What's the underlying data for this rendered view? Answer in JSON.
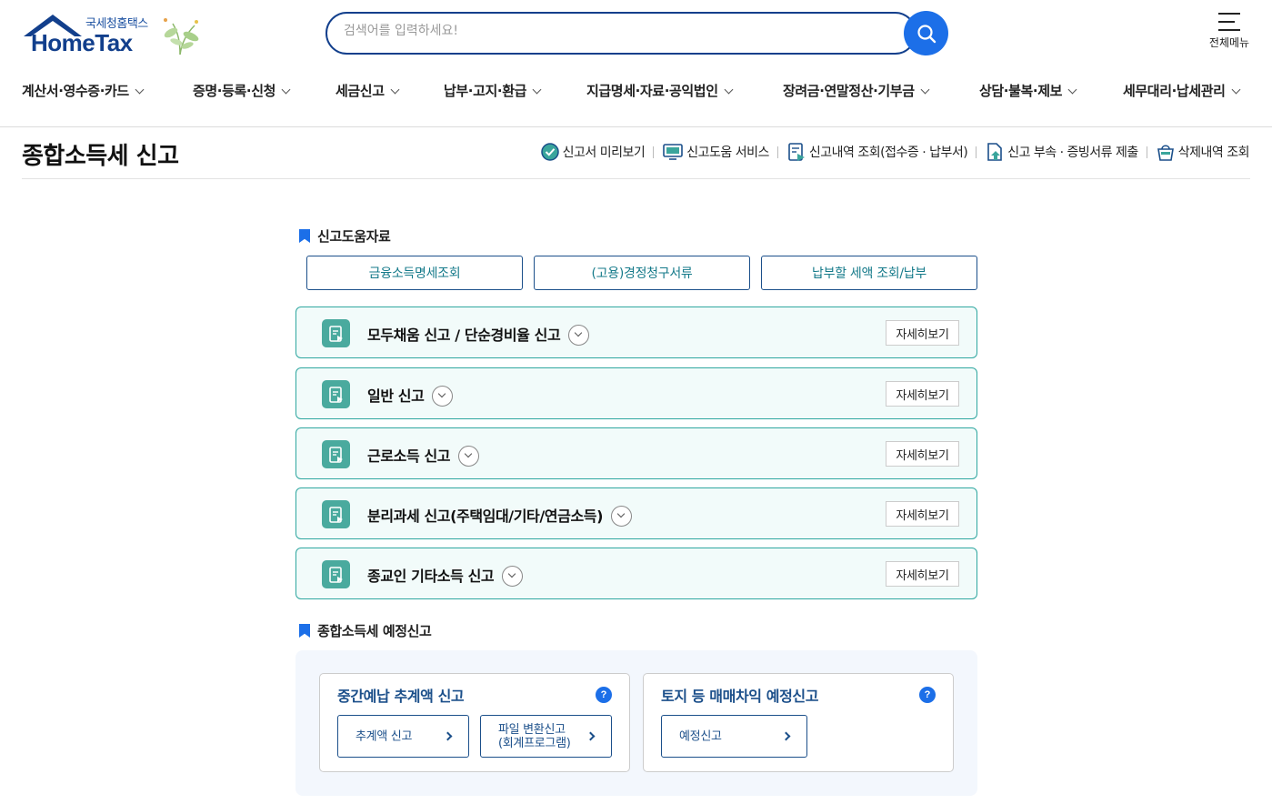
{
  "header": {
    "logo_sub": "국세청홈택스",
    "logo_main": "HomeTax",
    "search_placeholder": "검색어를 입력하세요!",
    "menu_label": "전체메뉴"
  },
  "gnb": [
    "계산서·영수증·카드",
    "증명·등록·신청",
    "세금신고",
    "납부·고지·환급",
    "지급명세·자료·공익법인",
    "장려금·연말정산·기부금",
    "상담·불복·제보",
    "세무대리·납세관리"
  ],
  "page": {
    "title": "종합소득세 신고",
    "quick_links": [
      {
        "label": "신고서 미리보기",
        "icon": "check-circle-icon"
      },
      {
        "label": "신고도움 서비스",
        "icon": "monitor-icon"
      },
      {
        "label": "신고내역 조회(접수증 · 납부서)",
        "icon": "document-search-icon"
      },
      {
        "label": "신고 부속 · 증빙서류 제출",
        "icon": "document-upload-icon"
      },
      {
        "label": "삭제내역 조회",
        "icon": "trash-basket-icon"
      }
    ]
  },
  "help_section": {
    "title": "신고도움자료",
    "buttons": [
      "금융소득명세조회",
      "(고용)경정청구서류",
      "납부할 세액 조회/납부"
    ]
  },
  "filing_types": [
    {
      "title": "모두채움 신고 / 단순경비율 신고",
      "more": "자세히보기"
    },
    {
      "title": "일반 신고",
      "more": "자세히보기"
    },
    {
      "title": "근로소득 신고",
      "more": "자세히보기"
    },
    {
      "title": "분리과세 신고(주택임대/기타/연금소득)",
      "more": "자세히보기"
    },
    {
      "title": "종교인 기타소득 신고",
      "more": "자세히보기"
    }
  ],
  "estimated_section": {
    "title": "종합소득세 예정신고",
    "cards": [
      {
        "title": "중간예납 추계액 신고",
        "help": "?",
        "buttons": [
          "추계액 신고",
          "파일 변환신고\n(회계프로그램)"
        ]
      },
      {
        "title": "토지 등 매매차익 예정신고",
        "help": "?",
        "buttons": [
          "예정신고"
        ]
      }
    ]
  },
  "colors": {
    "brand_navy": "#123f8c",
    "accent_blue": "#1c6fe8",
    "accordion_border": "#2fa7a0",
    "accordion_bg": "#f2fbfa",
    "icon_teal": "#4aaa9e"
  }
}
